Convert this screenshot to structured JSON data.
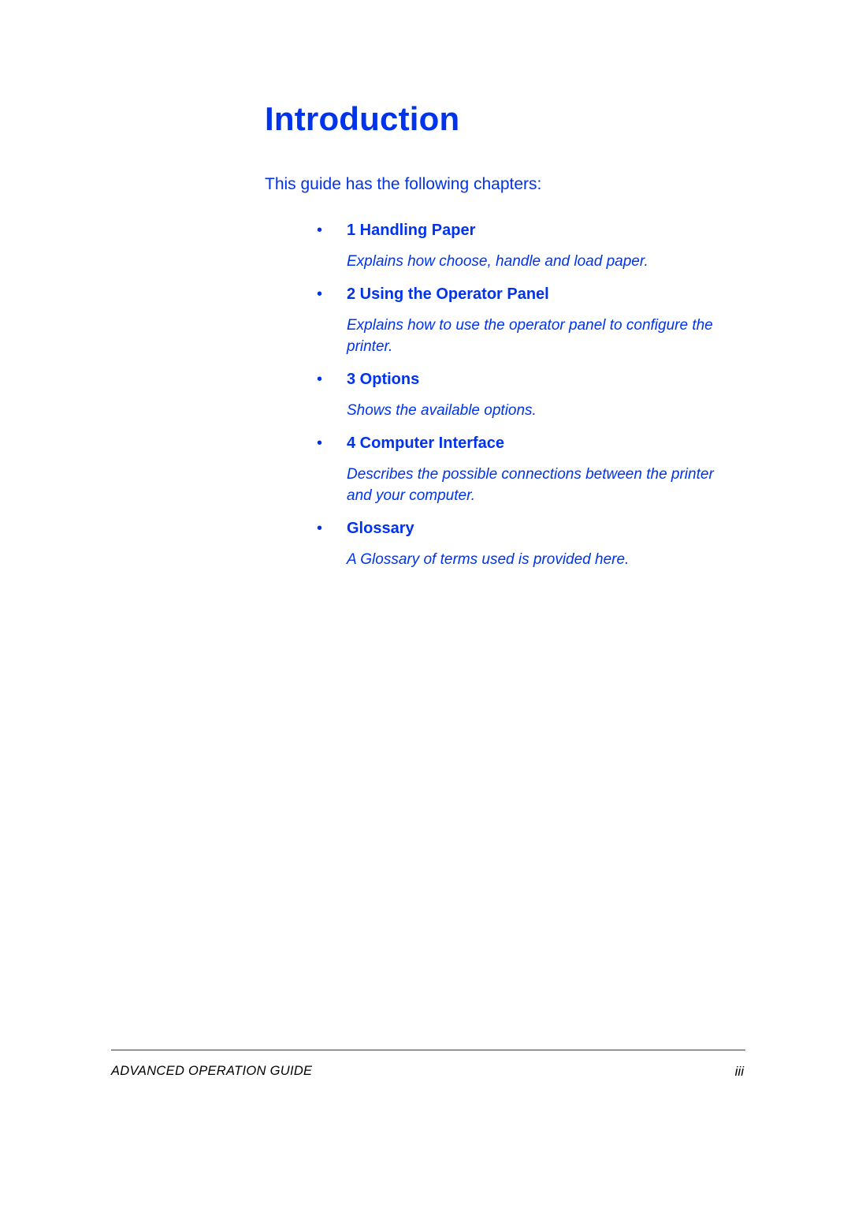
{
  "colors": {
    "accent": "#0033ee",
    "text": "#000000"
  },
  "title": "Introduction",
  "intro_line": "This guide has the following chapters:",
  "chapters": [
    {
      "label": "1 Handling Paper",
      "desc": "Explains how choose, handle and load paper."
    },
    {
      "label": "2 Using the Operator Panel",
      "desc": "Explains how to use the operator panel to configure the printer."
    },
    {
      "label": "3 Options",
      "desc": "Shows the available options."
    },
    {
      "label": "4 Computer Interface",
      "desc": "Describes the possible connections between the printer and your computer."
    },
    {
      "label": " Glossary",
      "desc": "A Glossary of terms used is provided here."
    }
  ],
  "footer": {
    "left": "ADVANCED OPERATION GUIDE",
    "right": "iii"
  }
}
